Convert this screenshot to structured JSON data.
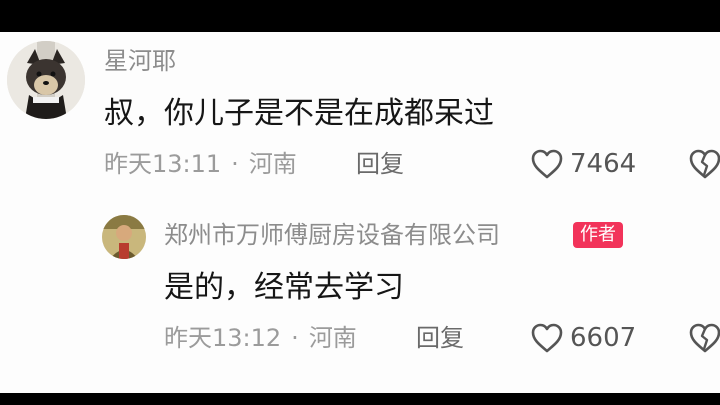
{
  "comments": [
    {
      "username": "星河耶",
      "text": "叔，你儿子是不是在成都呆过",
      "time": "昨天13:11",
      "location": "河南",
      "reply_label": "回复",
      "likes": "7464"
    },
    {
      "username": "郑州市万师傅厨房设备有限公司",
      "badge": "作者",
      "text": "是的，经常去学习",
      "time": "昨天13:12",
      "location": "河南",
      "reply_label": "回复",
      "likes": "6607"
    }
  ],
  "separator": "·",
  "colors": {
    "badge": "#f2335a",
    "background": "#fdfdfd"
  }
}
